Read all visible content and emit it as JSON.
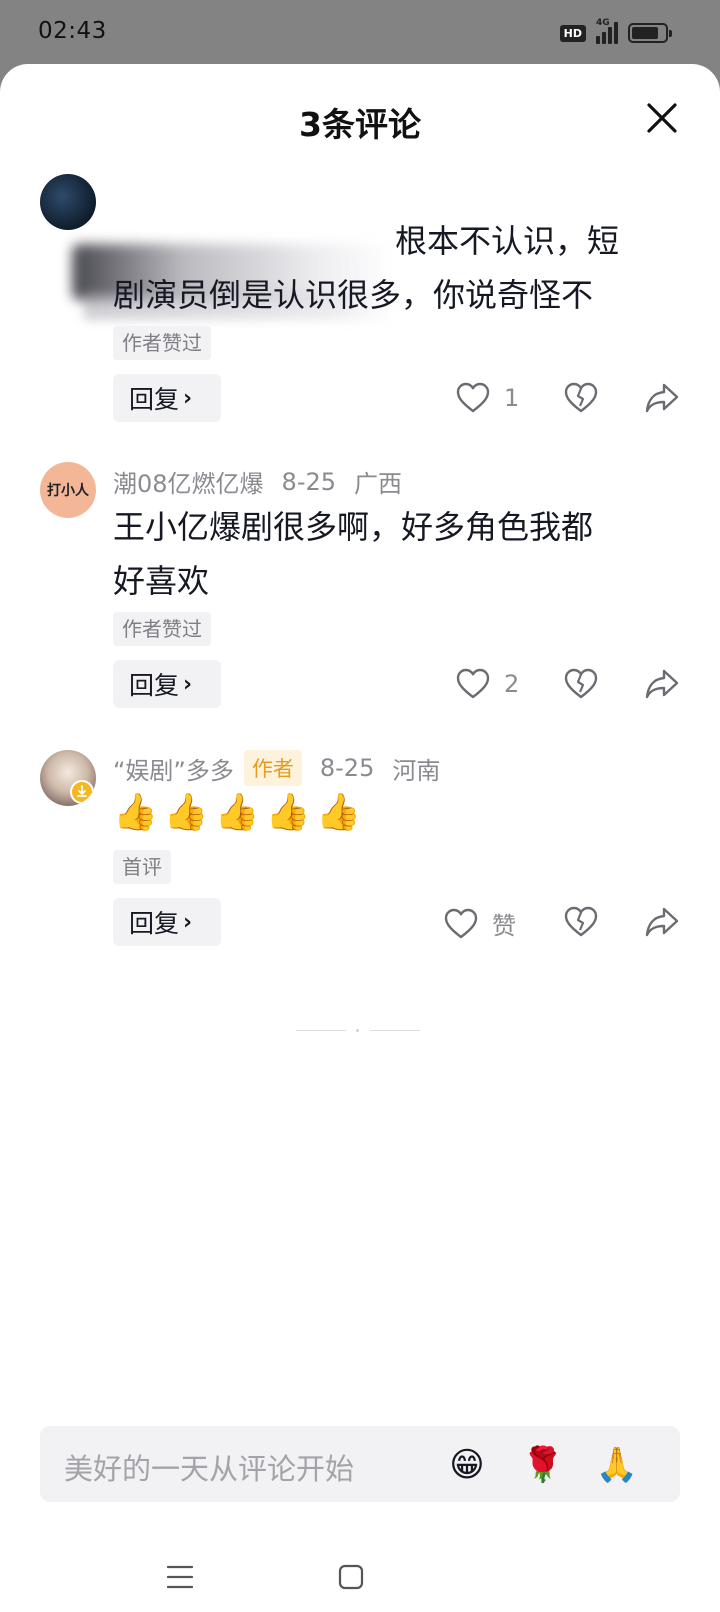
{
  "status_bar": {
    "time": "02:43",
    "hd": "HD",
    "network": "4G"
  },
  "sheet": {
    "title": "3条评论"
  },
  "comments": [
    {
      "text_lines": [
        "根本不认识，短",
        "剧演员倒是认识很多，你说奇怪不"
      ],
      "tag": "作者赞过",
      "reply_label": "回复",
      "likes": "1"
    },
    {
      "avatar_text": "打小人",
      "user": "潮08亿燃亿爆",
      "date": "8-25",
      "location": "广西",
      "text_lines": [
        "王小亿爆剧很多啊，好多角色我都",
        "好喜欢"
      ],
      "tag": "作者赞过",
      "reply_label": "回复",
      "likes": "2"
    },
    {
      "user": "“娱剧”多多",
      "author_tag": "作者",
      "date": "8-25",
      "location": "河南",
      "text": "👍👍👍👍👍",
      "tag": "首评",
      "reply_label": "回复",
      "likes": "赞"
    }
  ],
  "input": {
    "placeholder": "美好的一天从评论开始",
    "emojis": [
      "😁",
      "🌹",
      "🙏"
    ]
  },
  "colors": {
    "accent_author": "#e69c1f",
    "background_dim": "#838383"
  }
}
